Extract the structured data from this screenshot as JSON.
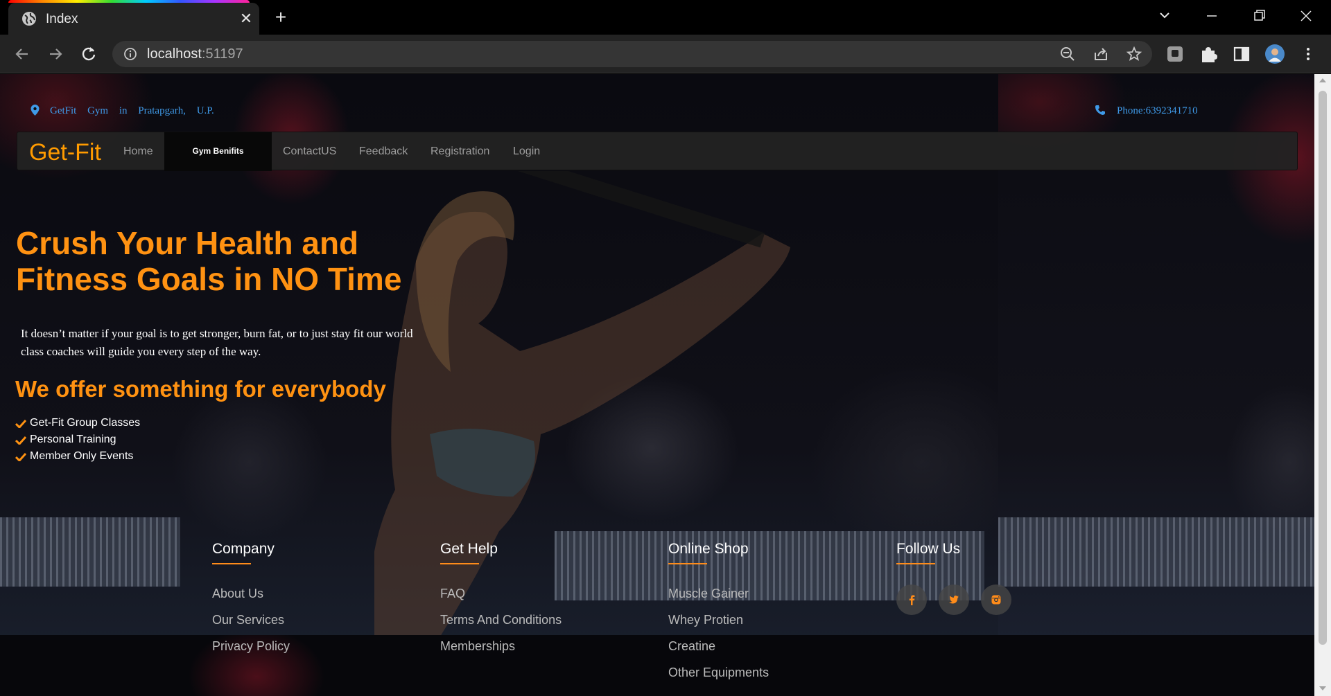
{
  "browser": {
    "tab_title": "Index",
    "new_tab_symbol": "+",
    "close_symbol": "✕",
    "url_host": "localhost",
    "url_port": ":51197",
    "window_controls": [
      "minimize-icon",
      "restore-icon",
      "close-icon"
    ]
  },
  "topbar": {
    "location": "GetFit Gym in Pratapgarh, U.P.",
    "phone": "Phone:6392341710"
  },
  "nav": {
    "brand": "Get-Fit",
    "links": [
      "Home",
      "Gym Benifits",
      "ContactUS",
      "Feedback",
      "Registration",
      "Login"
    ],
    "active": "Gym Benifits"
  },
  "hero": {
    "title": "Crush Your Health and Fitness Goals in NO Time",
    "text": "It doesn’t matter if your goal is to get stronger, burn fat, or to just stay fit our world class coaches will guide you every step of the way.",
    "offer_title": "We offer something for everybody",
    "offers": [
      "Get-Fit Group Classes",
      "Personal Training",
      "Member Only Events"
    ]
  },
  "footer": {
    "company": {
      "heading": "Company",
      "links": [
        "About Us",
        "Our Services",
        "Privacy Policy"
      ]
    },
    "help": {
      "heading": "Get Help",
      "links": [
        "FAQ",
        "Terms And Conditions",
        "Memberships"
      ]
    },
    "shop": {
      "heading": "Online Shop",
      "links": [
        "Muscle Gainer",
        "Whey Protien",
        "Creatine",
        "Other Equipments"
      ]
    },
    "follow": {
      "heading": "Follow Us",
      "icons": [
        "facebook-icon",
        "twitter-icon",
        "instagram-icon"
      ]
    }
  },
  "colors": {
    "accent_orange": "#ff9212",
    "link_blue": "#3f9ae8",
    "navbar_bg": "#222222"
  }
}
